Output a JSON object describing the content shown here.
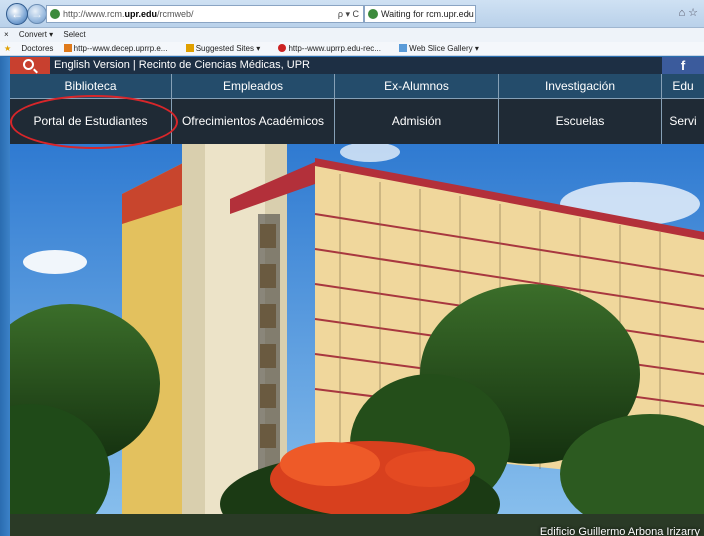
{
  "browser": {
    "url_prefix": "http://www.rcm.",
    "url_domain": "upr.edu",
    "url_suffix": "/rcmweb/",
    "address_controls": "ρ ▾ C",
    "tab_title": "Waiting for rcm.upr.edu",
    "tab_close": "×",
    "window_icons": "⌂ ☆",
    "back_glyph": "←",
    "forward_glyph": "→"
  },
  "command_bar": {
    "close": "×",
    "convert": "Convert ▾",
    "select": "Select"
  },
  "favorites_bar": {
    "items": [
      "Doctores",
      "http--www.decep.uprrp.e...",
      "Suggested Sites ▾",
      "http--www.uprrp.edu-rec...",
      "Web Slice Gallery ▾"
    ]
  },
  "site": {
    "top_strip": "English Version  |  Recinto de Ciencias Médicas, UPR",
    "facebook": "f",
    "nav_primary": [
      "Biblioteca",
      "Empleados",
      "Ex-Alumnos",
      "Investigación",
      "Edu"
    ],
    "nav_secondary": [
      "Portal de Estudiantes",
      "Ofrecimientos Académicos",
      "Admisión",
      "Escuelas",
      "Servi"
    ],
    "hero_caption": "Edificio Guillermo Arbona Irizarry"
  },
  "colors": {
    "search_box": "#c8402f",
    "nav_primary_bg": "#244c6b",
    "nav_secondary_bg": "#1f2a35",
    "highlight_circle": "#d8262a",
    "facebook": "#3b5b9c"
  }
}
